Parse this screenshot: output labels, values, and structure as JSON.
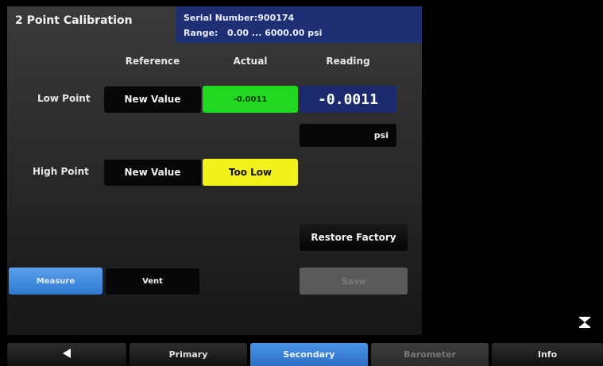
{
  "header": {
    "title": "2 Point Calibration",
    "serial_line": "Serial Number:900174",
    "range_line": "Range:   0.00 ... 6000.00 psi"
  },
  "columns": {
    "reference": "Reference",
    "actual": "Actual",
    "reading": "Reading"
  },
  "low_point": {
    "label": "Low Point",
    "reference_button": "New Value",
    "actual_value": "-0.0011",
    "reading_value": "-0.0011"
  },
  "unit": "psi",
  "high_point": {
    "label": "High Point",
    "reference_button": "New Value",
    "actual_status": "Too Low"
  },
  "buttons": {
    "restore_factory": "Restore Factory",
    "measure": "Measure",
    "vent": "Vent",
    "save": "Save"
  },
  "tabs": {
    "back_icon": "triangle-left-icon",
    "primary": "Primary",
    "secondary": "Secondary",
    "barometer": "Barometer",
    "info": "Info"
  },
  "status_icon": "hourglass-icon",
  "colors": {
    "accent_blue": "#2f79d0",
    "serial_box": "#1f2f73",
    "ok_green": "#1fd81f",
    "warn_yellow": "#f3f21d"
  }
}
